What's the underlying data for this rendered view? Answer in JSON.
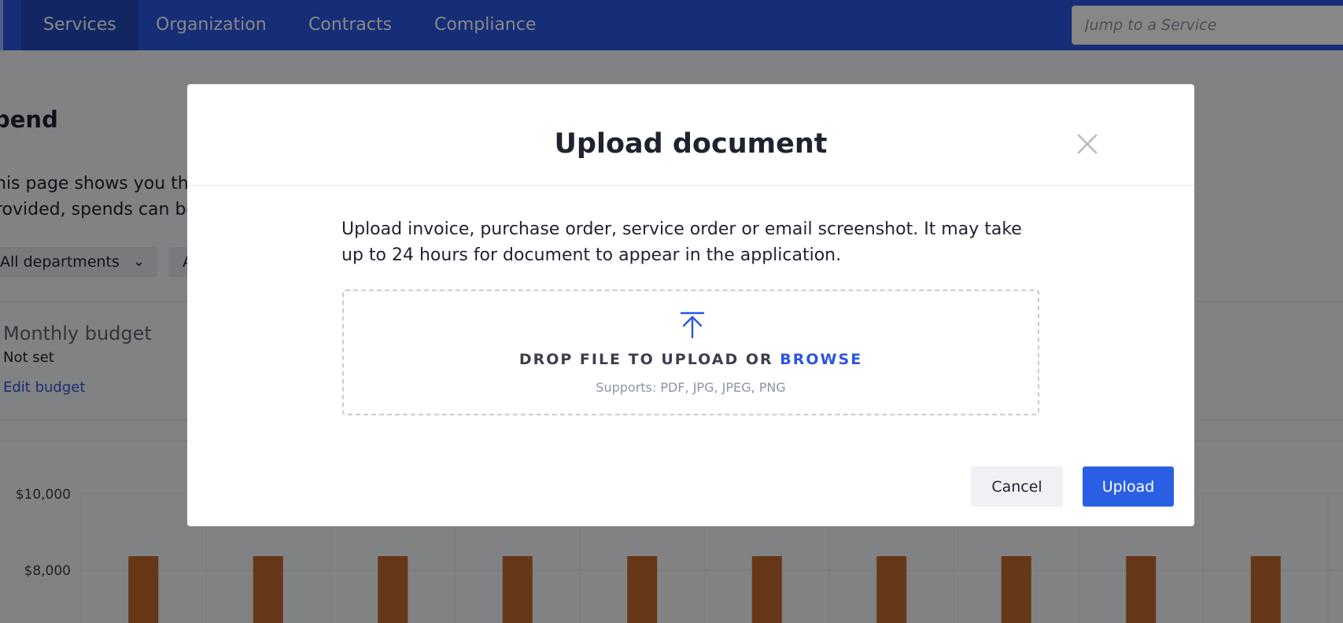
{
  "nav": {
    "items": [
      {
        "label": "Services",
        "active": true
      },
      {
        "label": "Organization",
        "active": false
      },
      {
        "label": "Contracts",
        "active": false
      },
      {
        "label": "Compliance",
        "active": false
      }
    ],
    "search_placeholder": "Jump to a Service"
  },
  "page": {
    "title": "pend",
    "description_lines": [
      "his page shows you the",
      "rovided, spends can be"
    ],
    "filters": [
      {
        "label": "All departments",
        "icon": "chevron-down-icon"
      },
      {
        "label": "A"
      }
    ],
    "budget": {
      "title": "Monthly budget",
      "value": "Not set",
      "edit_label": "Edit budget"
    }
  },
  "chart_data": {
    "type": "bar",
    "ytick_labels": [
      "$10,000",
      "$8,000"
    ],
    "bar_count": 10,
    "bar_color": "#c06a2f",
    "grid": true
  },
  "modal": {
    "title": "Upload document",
    "description": "Upload invoice, purchase order, service order or email screenshot. It may take up to 24 hours for document to appear in the application.",
    "dropzone": {
      "prompt": "DROP FILE TO UPLOAD OR ",
      "browse_label": "BROWSE",
      "supports": "Supports: PDF, JPG, JPEG, PNG",
      "icon": "upload-icon"
    },
    "cancel_label": "Cancel",
    "upload_label": "Upload",
    "close_icon": "close-icon"
  },
  "colors": {
    "nav_bg": "#2b56e0",
    "accent": "#2b5fe3",
    "overlay": "rgba(0,0,0,0.47)"
  }
}
